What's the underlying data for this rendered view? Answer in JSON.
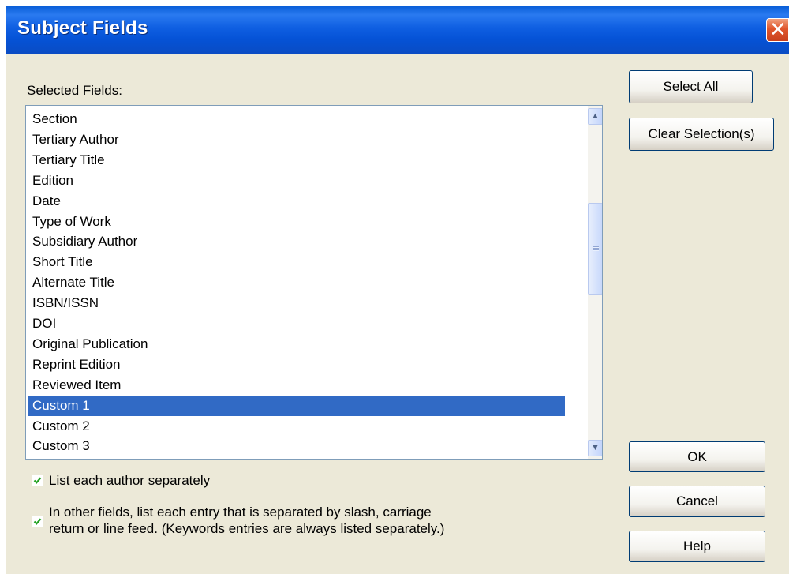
{
  "dialog": {
    "title": "Subject Fields",
    "close_icon": "close-icon"
  },
  "list_label": "Selected Fields:",
  "fields": [
    {
      "label": "Section",
      "selected": false
    },
    {
      "label": "Tertiary Author",
      "selected": false
    },
    {
      "label": "Tertiary Title",
      "selected": false
    },
    {
      "label": "Edition",
      "selected": false
    },
    {
      "label": "Date",
      "selected": false
    },
    {
      "label": "Type of Work",
      "selected": false
    },
    {
      "label": "Subsidiary Author",
      "selected": false
    },
    {
      "label": "Short Title",
      "selected": false
    },
    {
      "label": "Alternate Title",
      "selected": false
    },
    {
      "label": "ISBN/ISSN",
      "selected": false
    },
    {
      "label": "DOI",
      "selected": false
    },
    {
      "label": "Original Publication",
      "selected": false
    },
    {
      "label": "Reprint Edition",
      "selected": false
    },
    {
      "label": "Reviewed Item",
      "selected": false
    },
    {
      "label": "Custom 1",
      "selected": true
    },
    {
      "label": "Custom 2",
      "selected": false
    },
    {
      "label": "Custom 3",
      "selected": false
    }
  ],
  "buttons": {
    "select_all": "Select All",
    "clear_selection": "Clear Selection(s)",
    "ok": "OK",
    "cancel": "Cancel",
    "help": "Help"
  },
  "options": {
    "list_authors_separately": {
      "label": "List each author separately",
      "checked": true
    },
    "list_entries_separately": {
      "line1": "In other fields, list each entry that is separated by slash, carriage",
      "line2": "return or line feed. (Keywords entries are always listed separately.)",
      "checked": true
    }
  },
  "colors": {
    "title_bar": "#0a5fd8",
    "dialog_bg": "#ece9d8",
    "selection": "#316ac5",
    "checkmark": "#21a121"
  }
}
